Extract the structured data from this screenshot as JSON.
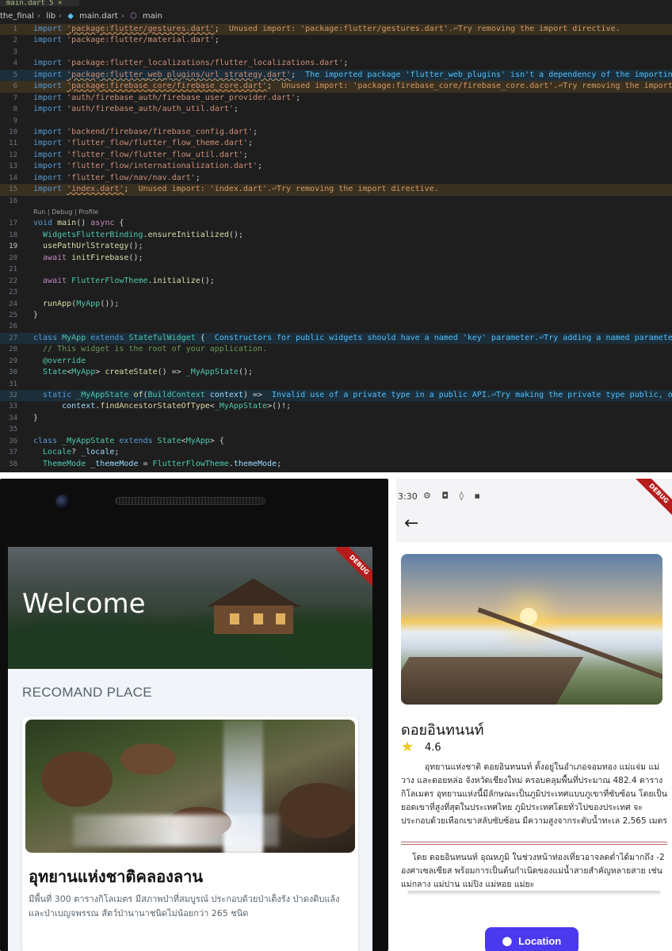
{
  "editor": {
    "tab": "main.dart 5 ×",
    "breadcrumb": [
      "the_final",
      "lib",
      "main.dart",
      "main"
    ],
    "codelens": "Run | Debug | Profile",
    "lines": [
      {
        "n": "1",
        "segs": [
          [
            "kw",
            "import "
          ],
          [
            "strw",
            "'package:flutter/gestures.dart'"
          ],
          [
            "pl",
            ";"
          ]
        ],
        "err": "Unused import: 'package:flutter/gestures.dart'.⏎Try removing the import directive.",
        "etype": "w"
      },
      {
        "n": "2",
        "segs": [
          [
            "kw",
            "import "
          ],
          [
            "str",
            "'package:flutter/material.dart'"
          ],
          [
            "pl",
            ";"
          ]
        ]
      },
      {
        "n": "3",
        "segs": []
      },
      {
        "n": "4",
        "segs": [
          [
            "kw",
            "import "
          ],
          [
            "str",
            "'package:flutter_localizations/flutter_localizations.dart'"
          ],
          [
            "pl",
            ";"
          ]
        ]
      },
      {
        "n": "5",
        "segs": [
          [
            "kw",
            "import "
          ],
          [
            "strw",
            "'package:flutter_web_plugins/url_strategy.dart'"
          ],
          [
            "pl",
            ";"
          ]
        ],
        "err": "The imported package 'flutter_web_plugins' isn't a dependency of the importing",
        "etype": "i"
      },
      {
        "n": "6",
        "segs": [
          [
            "kw",
            "import "
          ],
          [
            "strw",
            "'package:firebase_core/firebase_core.dart'"
          ],
          [
            "pl",
            ";"
          ]
        ],
        "err": "Unused import: 'package:firebase_core/firebase_core.dart'.⏎Try removing the import d",
        "etype": "w"
      },
      {
        "n": "7",
        "segs": [
          [
            "kw",
            "import "
          ],
          [
            "str",
            "'auth/firebase_auth/firebase_user_provider.dart'"
          ],
          [
            "pl",
            ";"
          ]
        ]
      },
      {
        "n": "8",
        "segs": [
          [
            "kw",
            "import "
          ],
          [
            "str",
            "'auth/firebase_auth/auth_util.dart'"
          ],
          [
            "pl",
            ";"
          ]
        ]
      },
      {
        "n": "9",
        "segs": []
      },
      {
        "n": "10",
        "segs": [
          [
            "kw",
            "import "
          ],
          [
            "str",
            "'backend/firebase/firebase_config.dart'"
          ],
          [
            "pl",
            ";"
          ]
        ]
      },
      {
        "n": "11",
        "segs": [
          [
            "kw",
            "import "
          ],
          [
            "str",
            "'flutter_flow/flutter_flow_theme.dart'"
          ],
          [
            "pl",
            ";"
          ]
        ]
      },
      {
        "n": "12",
        "segs": [
          [
            "kw",
            "import "
          ],
          [
            "str",
            "'flutter_flow/flutter_flow_util.dart'"
          ],
          [
            "pl",
            ";"
          ]
        ]
      },
      {
        "n": "13",
        "segs": [
          [
            "kw",
            "import "
          ],
          [
            "str",
            "'flutter_flow/internationalization.dart'"
          ],
          [
            "pl",
            ";"
          ]
        ]
      },
      {
        "n": "14",
        "segs": [
          [
            "kw",
            "import "
          ],
          [
            "str",
            "'flutter_flow/nav/nav.dart'"
          ],
          [
            "pl",
            ";"
          ]
        ]
      },
      {
        "n": "15",
        "segs": [
          [
            "kw",
            "import "
          ],
          [
            "strw",
            "'index.dart'"
          ],
          [
            "pl",
            ";"
          ]
        ],
        "err": "Unused import: 'index.dart'.⏎Try removing the import directive.",
        "etype": "w"
      },
      {
        "n": "16",
        "segs": []
      },
      {
        "n": "17",
        "segs": [
          [
            "kw",
            "void "
          ],
          [
            "fn",
            "main"
          ],
          [
            "pl",
            "() "
          ],
          [
            "kw2",
            "async"
          ],
          [
            "pl",
            " {"
          ]
        ]
      },
      {
        "n": "18",
        "segs": [
          [
            "cls",
            "  WidgetsFlutterBinding"
          ],
          [
            "pl",
            "."
          ],
          [
            "fn",
            "ensureInitialized"
          ],
          [
            "pl",
            "();"
          ]
        ]
      },
      {
        "n": "19",
        "segs": [
          [
            "fn",
            "  usePathUrlStrategy"
          ],
          [
            "pl",
            "();"
          ]
        ]
      },
      {
        "n": "20",
        "segs": [
          [
            "kw2",
            "  await "
          ],
          [
            "fn",
            "initFirebase"
          ],
          [
            "pl",
            "();"
          ]
        ]
      },
      {
        "n": "21",
        "segs": []
      },
      {
        "n": "22",
        "segs": [
          [
            "kw2",
            "  await "
          ],
          [
            "cls",
            "FlutterFlowTheme"
          ],
          [
            "pl",
            "."
          ],
          [
            "fn",
            "initialize"
          ],
          [
            "pl",
            "();"
          ]
        ]
      },
      {
        "n": "23",
        "segs": []
      },
      {
        "n": "24",
        "segs": [
          [
            "fn",
            "  runApp"
          ],
          [
            "pl",
            "("
          ],
          [
            "cls",
            "MyApp"
          ],
          [
            "pl",
            "());"
          ]
        ]
      },
      {
        "n": "25",
        "segs": [
          [
            "pl",
            "}"
          ]
        ]
      },
      {
        "n": "26",
        "segs": []
      },
      {
        "n": "27",
        "segs": [
          [
            "kw",
            "class "
          ],
          [
            "cls",
            "MyApp"
          ],
          [
            "kw",
            " extends "
          ],
          [
            "cls",
            "StatefulWidget"
          ],
          [
            "pl",
            " {"
          ]
        ],
        "err": "Constructors for public widgets should have a named 'key' parameter.⏎Try adding a named parameter",
        "etype": "i"
      },
      {
        "n": "28",
        "segs": [
          [
            "cmt",
            "  // This widget is the root of your application."
          ]
        ]
      },
      {
        "n": "29",
        "segs": [
          [
            "dec",
            "  @override"
          ]
        ]
      },
      {
        "n": "30",
        "segs": [
          [
            "cls",
            "  State"
          ],
          [
            "pl",
            "<"
          ],
          [
            "cls",
            "MyApp"
          ],
          [
            "pl",
            "> "
          ],
          [
            "fn",
            "createState"
          ],
          [
            "pl",
            "() => "
          ],
          [
            "cls",
            "_MyAppState"
          ],
          [
            "pl",
            "();"
          ]
        ]
      },
      {
        "n": "31",
        "segs": []
      },
      {
        "n": "32",
        "segs": [
          [
            "kw",
            "  static "
          ],
          [
            "cls",
            "_MyAppState"
          ],
          [
            "fn",
            " of"
          ],
          [
            "pl",
            "("
          ],
          [
            "cls",
            "BuildContext"
          ],
          [
            "var",
            " context"
          ],
          [
            "pl",
            ") =>"
          ]
        ],
        "err": "Invalid use of a private type in a public API.⏎Try making the private type public, or",
        "etype": "i"
      },
      {
        "n": "33",
        "segs": [
          [
            "var",
            "      context"
          ],
          [
            "pl",
            "."
          ],
          [
            "fn",
            "findAncestorStateOfType"
          ],
          [
            "pl",
            "<"
          ],
          [
            "cls",
            "_MyAppState"
          ],
          [
            "pl",
            ">()!;"
          ]
        ]
      },
      {
        "n": "34",
        "segs": [
          [
            "pl",
            "}"
          ]
        ]
      },
      {
        "n": "35",
        "segs": []
      },
      {
        "n": "36",
        "segs": [
          [
            "kw",
            "class "
          ],
          [
            "cls",
            "_MyAppState"
          ],
          [
            "kw",
            " extends "
          ],
          [
            "cls",
            "State"
          ],
          [
            "pl",
            "<"
          ],
          [
            "cls",
            "MyApp"
          ],
          [
            "pl",
            "> {"
          ]
        ]
      },
      {
        "n": "37",
        "segs": [
          [
            "cls",
            "  Locale"
          ],
          [
            "pl",
            "? "
          ],
          [
            "var",
            "_locale"
          ],
          [
            "pl",
            ";"
          ]
        ]
      },
      {
        "n": "38",
        "segs": [
          [
            "cls",
            "  ThemeMode"
          ],
          [
            "var",
            " _themeMode"
          ],
          [
            "pl",
            " = "
          ],
          [
            "cls",
            "FlutterFlowTheme"
          ],
          [
            "pl",
            "."
          ],
          [
            "var",
            "themeMode"
          ],
          [
            "pl",
            ";"
          ]
        ]
      }
    ]
  },
  "left_phone": {
    "welcome": "Welcome",
    "debug_banner": "DEBUG",
    "section_title": "RECOMAND PLACE",
    "place_name": "อุทยานแห่งชาติคลองลาน",
    "place_desc": "มีพื้นที่ 300 ตารางกิโลเมตร มีสภาพป่าที่สมบูรณ์ ประกอบด้วยป่าเต็งรัง ป่าดงดิบแล้ง และป่าเบญจพรรณ สัตว์ป่านานาชนิดไม่น้อยกว่า 265 ชนิด"
  },
  "right_phone": {
    "time": "3:30",
    "status_icons": "⚙ ◘ ◊ ▪",
    "back_icon": "←",
    "debug_banner": "DEBUG",
    "title": "ดอยอินทนนท์",
    "rating": "4.6",
    "desc": "อุทยานแห่งชาติ ดอยอินทนนท์ ตั้งอยู่ในอำเภอจอมทอง แม่แจ่ม แม่วาง และดอยหล่อ จังหวัดเชียงใหม่ ครอบคลุมพื้นที่ประมาณ 482.4 ตารางกิโลเมตร อุทยานแห่งนี้มีลักษณะเป็นภูมิประเทศแบบภูเขาที่ซับซ้อน โดยเป็นยอดเขาที่สูงที่สุดในประเทศไทย ภูมิประเทศโดยทั่วไปของประเทศ จะประกอบด้วยเทือกเขาสลับซับซ้อน มีความสูงจากระดับน้ำทะเล 2,565 เมตร",
    "desc2": "โดย ดอยอินทนนท์ อุณหภูมิ ในช่วงหน้าท่องเที่ยวอาจลดต่ำได้มากถึง -2 องศาเซลเซียส พร้อมการเป็นต้นกำเนิดของแม่น้ำสายสำคัญหลายสาย เช่น แม่กลาง แม่ปาน แม่ปิง แม่หอย แม่ยะ",
    "button_label": "Location",
    "accent": "#4b39ef"
  }
}
